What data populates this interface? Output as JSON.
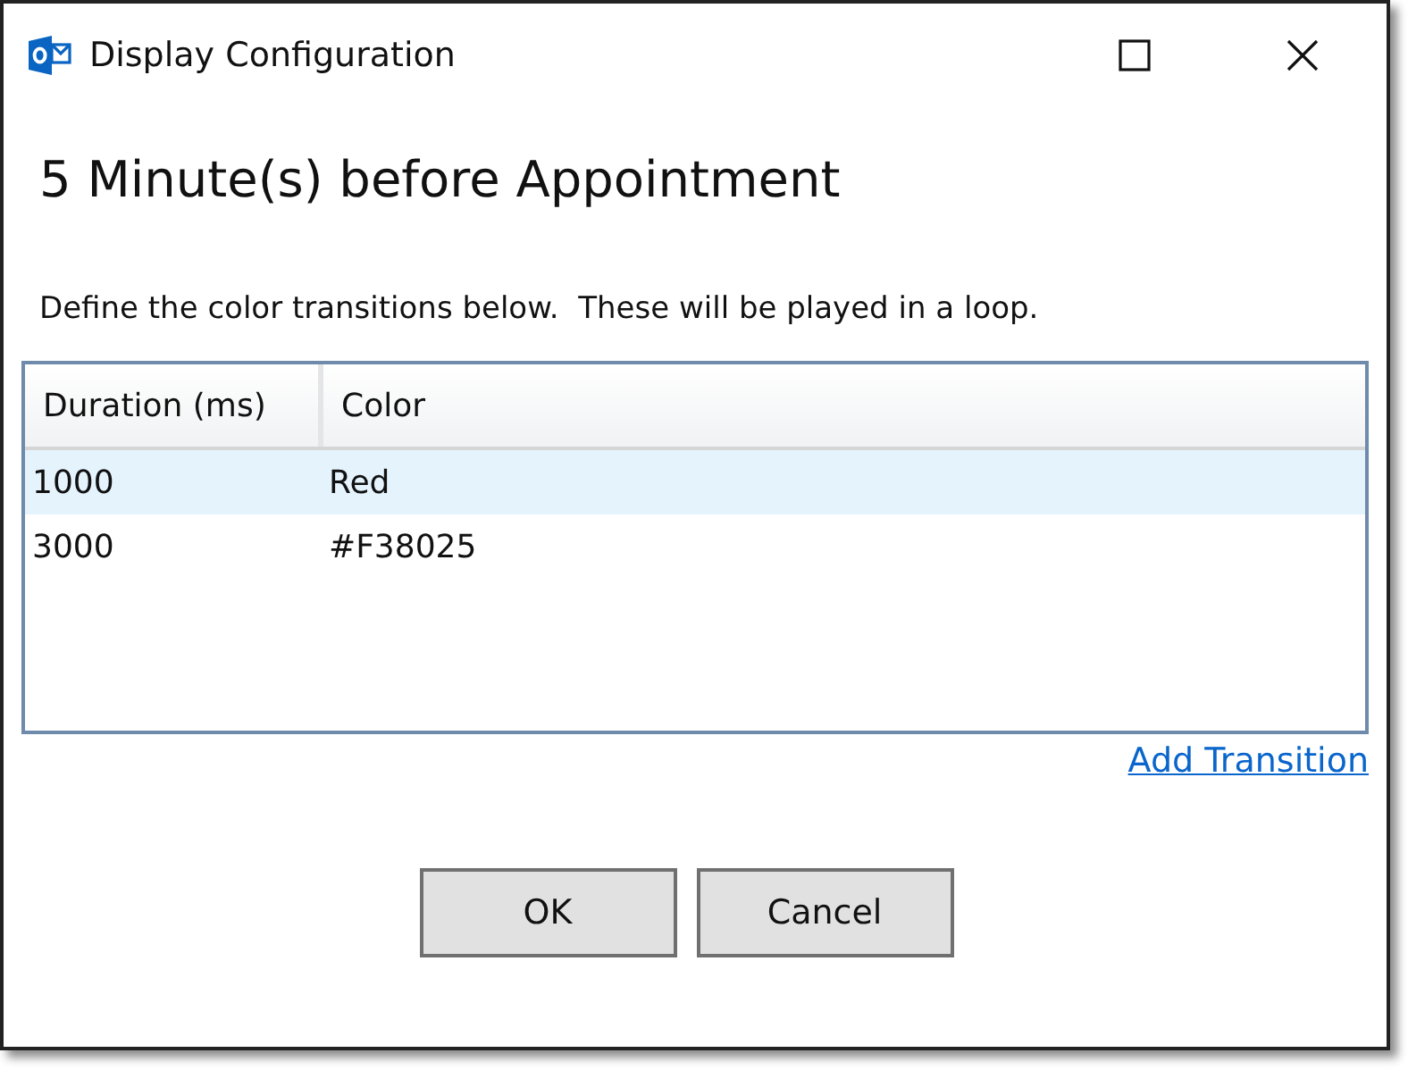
{
  "window": {
    "title": "Display Configuration"
  },
  "heading": "5 Minute(s) before Appointment",
  "description": "Define the color transitions below.  These will be played in a loop.",
  "table": {
    "columns": [
      "Duration (ms)",
      "Color"
    ],
    "rows": [
      {
        "cells": [
          "1000",
          "Red"
        ],
        "selected": true
      },
      {
        "cells": [
          "3000",
          "#F38025"
        ],
        "selected": false
      }
    ]
  },
  "add_link": "Add Transition",
  "buttons": [
    "OK",
    "Cancel"
  ]
}
